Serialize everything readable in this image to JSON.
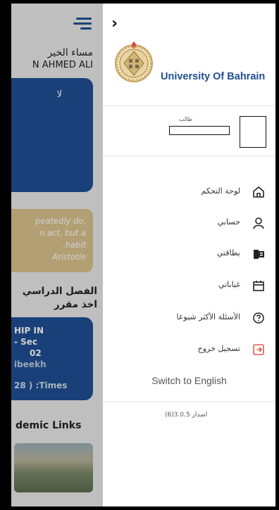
{
  "background": {
    "greeting": "مساء الخير",
    "student_name": "N AHMED ALI",
    "alert_card_text": "لا",
    "quote_lines": [
      "peatedly do.",
      "n act, but a",
      ".habit",
      "Aristotle"
    ],
    "semester_title": "الفصل الدراسي",
    "semester_subtitle": "اخذ مقرر",
    "course_lines": [
      "HIP IN",
      "- Sec",
      "02",
      "ibeekh",
      "28 ) :Times"
    ],
    "links_title": "demic Links"
  },
  "drawer": {
    "back_icon": "chevron-right",
    "university_name": "University Of Bahrain",
    "user_role": "طالب",
    "menu": [
      {
        "label": "لوحة التحكم",
        "icon": "home-icon"
      },
      {
        "label": "حسابي",
        "icon": "user-icon"
      },
      {
        "label": "بطاقتي",
        "icon": "id-card-icon"
      },
      {
        "label": "غياباتي",
        "icon": "calendar-icon"
      },
      {
        "label": "الأسئلة الأكثر شيوعا",
        "icon": "help-icon"
      },
      {
        "label": "تسجيل خروج",
        "icon": "logout-icon"
      }
    ],
    "switch_language": "Switch to English",
    "version": "اصدار 3.0.5(6)"
  },
  "colors": {
    "brand_blue": "#1f4f93",
    "logout_red": "#e0584f",
    "quote_gold": "#d9c38e"
  }
}
